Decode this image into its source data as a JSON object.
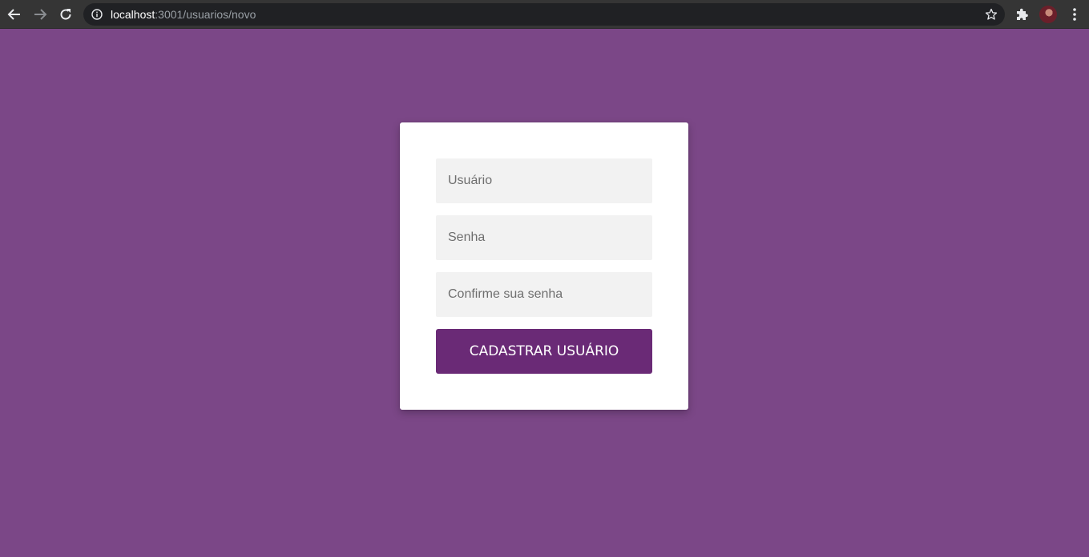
{
  "browser": {
    "url_host": "localhost",
    "url_path": ":3001/usuarios/novo",
    "icons": {
      "back": "arrow-left-icon",
      "forward": "arrow-right-icon",
      "reload": "reload-icon",
      "info": "info-icon",
      "bookmark": "star-icon",
      "extensions": "puzzle-icon",
      "menu": "kebab-menu-icon"
    }
  },
  "form": {
    "username_placeholder": "Usuário",
    "password_placeholder": "Senha",
    "confirm_placeholder": "Confirme sua senha",
    "submit_label": "CADASTRAR USUÁRIO"
  },
  "colors": {
    "background": "#7b4787",
    "button": "#6a2a76",
    "field": "#f2f2f2"
  }
}
